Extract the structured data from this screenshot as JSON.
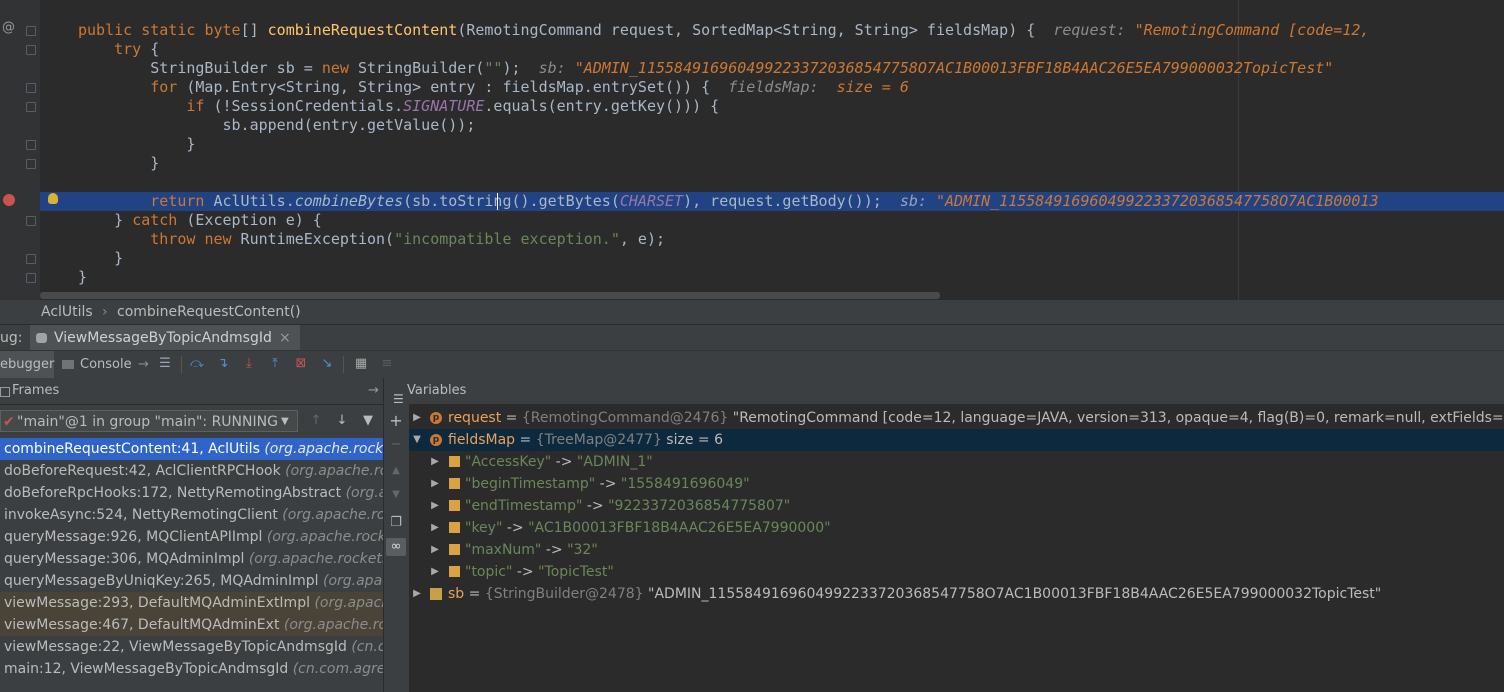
{
  "editor": {
    "line1": {
      "kw1": "public static",
      "kw2": "byte",
      "t1": "[] ",
      "fn": "combineRequestContent",
      "t2": "(RemotingCommand request, SortedMap<String, String> fieldsMap) {",
      "hint_label": "request:",
      "hint_value": "\"RemotingCommand [code=12,"
    },
    "line2": {
      "kw": "try",
      "t": " {"
    },
    "line3": {
      "t1": "StringBuilder sb = ",
      "kw": "new",
      "t2": " StringBuilder(",
      "str": "\"\"",
      "t3": ");",
      "hint_label": "sb:",
      "hint_value": "\"ADMIN_1155849169604992233720368547758O7AC1B00013FBF18B4AAC26E5EA799000032TopicTest\""
    },
    "line4": {
      "kw": "for",
      "t": " (Map.Entry<String, String> entry : fieldsMap.entrySet()) {",
      "hint_label": "fieldsMap:",
      "hint_value": "size = 6"
    },
    "line5": {
      "kw": "if",
      "t1": " (!SessionCredentials.",
      "st": "SIGNATURE",
      "t2": ".equals(entry.getKey())) {"
    },
    "line6": {
      "t": "sb.append(entry.getValue());"
    },
    "line7": {
      "t": "}"
    },
    "line8": {
      "t": "}"
    },
    "line9": {
      "kw": "return",
      "t1": " AclUtils.",
      "itf": "combineBytes",
      "t2": "(sb.toString().getBytes(",
      "st": "CHARSET",
      "t3": "), request.getBody());",
      "hint_label": "sb:",
      "hint_value": "\"ADMIN_1155849169604992233720368547758O7AC1B00013"
    },
    "line10": {
      "t1": "} ",
      "kw": "catch",
      "t2": " (Exception e) {"
    },
    "line11": {
      "kw1": "throw",
      "kw2": "new",
      "t1": " RuntimeException(",
      "str": "\"incompatible exception.\"",
      "t2": ", e);"
    },
    "line12": {
      "t": "}"
    },
    "line13": {
      "t": "}"
    }
  },
  "breadcrumb": {
    "class": "AclUtils",
    "sep": "›",
    "method": "combineRequestContent()"
  },
  "debug": {
    "label": "ug:",
    "session_tab": "ViewMessageByTopicAndmsgId",
    "close": "×",
    "tab_debugger": "ebugger",
    "tab_console": "Console"
  },
  "frames": {
    "title": "Frames",
    "thread": "\"main\"@1 in group \"main\": RUNNING",
    "items": [
      {
        "method": "combineRequestContent:41, AclUtils",
        "pkg": "(org.apache.rocket"
      },
      {
        "method": "doBeforeRequest:42, AclClientRPCHook",
        "pkg": "(org.apache.roc"
      },
      {
        "method": "doBeforeRpcHooks:172, NettyRemotingAbstract",
        "pkg": "(org.a"
      },
      {
        "method": "invokeAsync:524, NettyRemotingClient",
        "pkg": "(org.apache.rock"
      },
      {
        "method": "queryMessage:926, MQClientAPIImpl",
        "pkg": "(org.apache.rocket"
      },
      {
        "method": "queryMessage:306, MQAdminImpl",
        "pkg": "(org.apache.rocketmq"
      },
      {
        "method": "queryMessageByUniqKey:265, MQAdminImpl",
        "pkg": "(org.apach"
      },
      {
        "method": "viewMessage:293, DefaultMQAdminExtImpl",
        "pkg": "(org.apache"
      },
      {
        "method": "viewMessage:467, DefaultMQAdminExt",
        "pkg": "(org.apache.rocke"
      },
      {
        "method": "viewMessage:22, ViewMessageByTopicAndmsgId",
        "pkg": "(cn.co"
      },
      {
        "method": "main:12, ViewMessageByTopicAndmsgId",
        "pkg": "(cn.com.agree."
      }
    ]
  },
  "variables": {
    "title": "Variables",
    "request": {
      "badge": "p",
      "name": "request",
      "eq": " = ",
      "type": "{RemotingCommand@2476}",
      "value": " \"RemotingCommand [code=12, language=JAVA, version=313, opaque=4, flag(B)=0, remark=null, extFields={_UNIQUE"
    },
    "fieldsMap": {
      "badge": "p",
      "name": "fieldsMap",
      "eq": " = ",
      "type": "{TreeMap@2477}",
      "value": " size = 6"
    },
    "entries": [
      {
        "k": "\"AccessKey\"",
        "arrow": " -> ",
        "v": "\"ADMIN_1\""
      },
      {
        "k": "\"beginTimestamp\"",
        "arrow": " -> ",
        "v": "\"1558491696049\""
      },
      {
        "k": "\"endTimestamp\"",
        "arrow": " -> ",
        "v": "\"9223372036854775807\""
      },
      {
        "k": "\"key\"",
        "arrow": " -> ",
        "v": "\"AC1B00013FBF18B4AAC26E5EA7990000\""
      },
      {
        "k": "\"maxNum\"",
        "arrow": " -> ",
        "v": "\"32\""
      },
      {
        "k": "\"topic\"",
        "arrow": " -> ",
        "v": "\"TopicTest\""
      }
    ],
    "sb": {
      "name": "sb",
      "eq": " = ",
      "type": "{StringBuilder@2478}",
      "value": " \"ADMIN_1155849169604992233720368547758O7AC1B00013FBF18B4AAC26E5EA799000032TopicTest\""
    }
  }
}
